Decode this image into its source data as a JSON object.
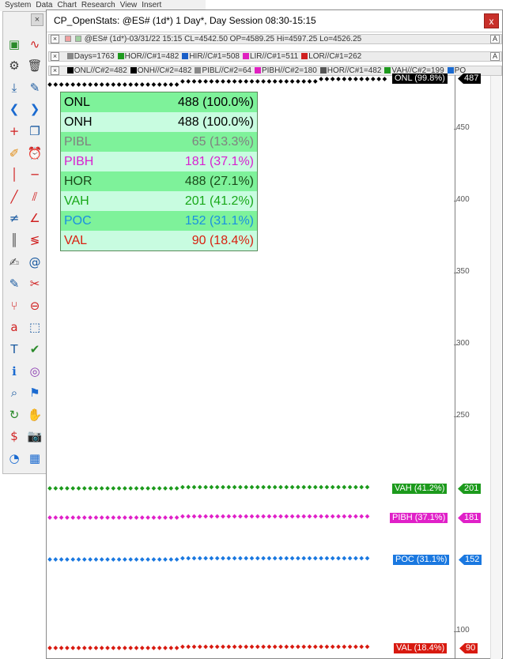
{
  "menubar": {
    "items": [
      "System",
      "Data",
      "Chart",
      "Research",
      "View",
      "Insert"
    ]
  },
  "toolbar": {
    "close_label": "×",
    "tools": [
      {
        "name": "add-chart-icon",
        "glyph": "▣",
        "color": "#2a8a2a"
      },
      {
        "name": "indicator-wave-icon",
        "glyph": "∿",
        "color": "#d02020"
      },
      {
        "name": "gear-icon",
        "glyph": "⚙",
        "color": "#3a3a3a"
      },
      {
        "name": "trash-icon",
        "glyph": "🗑",
        "color": "#3a3a3a"
      },
      {
        "name": "download-icon",
        "glyph": "⤓",
        "color": "#1a5aa0"
      },
      {
        "name": "pencil-icon",
        "glyph": "✎",
        "color": "#1a5aa0"
      },
      {
        "name": "arrow-left-icon",
        "glyph": "❮",
        "color": "#1a6ad0"
      },
      {
        "name": "arrow-right-icon",
        "glyph": "❯",
        "color": "#1a6ad0"
      },
      {
        "name": "crosshair-icon",
        "glyph": "+",
        "color": "#d02020"
      },
      {
        "name": "windows-icon",
        "glyph": "❐",
        "color": "#1a5aa0"
      },
      {
        "name": "note-icon",
        "glyph": "✐",
        "color": "#e08a10"
      },
      {
        "name": "alarm-clock-icon",
        "glyph": "⏰",
        "color": "#e08a10"
      },
      {
        "name": "vertical-line-icon",
        "glyph": "│",
        "color": "#d02020"
      },
      {
        "name": "horizontal-line-icon",
        "glyph": "─",
        "color": "#d02020"
      },
      {
        "name": "trendline-icon",
        "glyph": "╱",
        "color": "#d02020"
      },
      {
        "name": "parallel-lines-icon",
        "glyph": "⫽",
        "color": "#d02020"
      },
      {
        "name": "not-equal-icon",
        "glyph": "≠",
        "color": "#1a5aa0"
      },
      {
        "name": "fib-fan-icon",
        "glyph": "∠",
        "color": "#d02020"
      },
      {
        "name": "cycle-lines-icon",
        "glyph": "║",
        "color": "#555555"
      },
      {
        "name": "fib-retracement-icon",
        "glyph": "≶",
        "color": "#d02020"
      },
      {
        "name": "draw-pencil-icon",
        "glyph": "✍",
        "color": "#555555"
      },
      {
        "name": "spiral-icon",
        "glyph": "@",
        "color": "#1a5aa0"
      },
      {
        "name": "edit-lines-icon",
        "glyph": "✎",
        "color": "#1a5aa0"
      },
      {
        "name": "scissors-icon",
        "glyph": "✂",
        "color": "#d02020"
      },
      {
        "name": "pitchfork-icon",
        "glyph": "⑂",
        "color": "#d02020"
      },
      {
        "name": "candle-delete-icon",
        "glyph": "⊖",
        "color": "#d02020"
      },
      {
        "name": "text-tool-icon",
        "glyph": "a",
        "color": "#d02020"
      },
      {
        "name": "select-region-icon",
        "glyph": "⬚",
        "color": "#1a5aa0"
      },
      {
        "name": "title-tool-icon",
        "glyph": "T",
        "color": "#1a5aa0"
      },
      {
        "name": "spellcheck-icon",
        "glyph": "✔",
        "color": "#2a8a2a"
      },
      {
        "name": "info-icon",
        "glyph": "ℹ",
        "color": "#1a6ad0"
      },
      {
        "name": "overlay-circles-icon",
        "glyph": "◎",
        "color": "#8a3ab0"
      },
      {
        "name": "zoom-icon",
        "glyph": "⌕",
        "color": "#1a5aa0"
      },
      {
        "name": "flag-icon",
        "glyph": "⚑",
        "color": "#1a6ad0"
      },
      {
        "name": "refresh-icon",
        "glyph": "↻",
        "color": "#2a8a2a"
      },
      {
        "name": "hand-icon",
        "glyph": "✋",
        "color": "#e08a10"
      },
      {
        "name": "dollar-alert-icon",
        "glyph": "$",
        "color": "#d02020"
      },
      {
        "name": "camera-icon",
        "glyph": "📷",
        "color": "#3a3a3a"
      },
      {
        "name": "quick-search-icon",
        "glyph": "◔",
        "color": "#1a6ad0"
      },
      {
        "name": "grid-icon",
        "glyph": "▦",
        "color": "#1a6ad0"
      }
    ]
  },
  "window": {
    "title": "CP_OpenStats: @ES# (1d*) 1 Day*, Day Session 08:30-15:15",
    "close_label": "x"
  },
  "symbol_bar": {
    "close": "×",
    "text": "@ES# (1d*)-03/31/22 15:15 CL=4542.50 OP=4589.25 Hi=4597.25 Lo=4526.25",
    "a_label": "A"
  },
  "study_bar_1": {
    "close": "×",
    "items": [
      {
        "text": "Days=1763",
        "color": "#888888"
      },
      {
        "text": "HOR//C#1=482",
        "color": "#1f9a1f"
      },
      {
        "text": "HIR//C#1=508",
        "color": "#1a5fc8"
      },
      {
        "text": "LIR//C#1=511",
        "color": "#e020c0"
      },
      {
        "text": "LOR//C#1=262",
        "color": "#d02020"
      }
    ],
    "a_label": "A"
  },
  "study_bar_2": {
    "close": "×",
    "items": [
      {
        "text": "ONL//C#2=482",
        "color": "#000000"
      },
      {
        "text": "ONH//C#2=482",
        "color": "#000000"
      },
      {
        "text": "PIBL//C#2=64",
        "color": "#888888"
      },
      {
        "text": "PIBH//C#2=180",
        "color": "#e020c0"
      },
      {
        "text": "HOR//C#1=482",
        "color": "#555555"
      },
      {
        "text": "VAH//C#2=199",
        "color": "#1f9a1f"
      },
      {
        "text": "PO",
        "color": "#1a6ad0"
      }
    ]
  },
  "stats_table": [
    {
      "label": "ONL",
      "value": "488 (100.0%)",
      "color": "#000000",
      "bg": "#7ef29a"
    },
    {
      "label": "ONH",
      "value": "488 (100.0%)",
      "color": "#000000",
      "bg": "#c8fce0"
    },
    {
      "label": "PIBL",
      "value": "65 (13.3%)",
      "color": "#808080",
      "bg": "#7ef29a"
    },
    {
      "label": "PIBH",
      "value": "181 (37.1%)",
      "color": "#d820d0",
      "bg": "#c8fce0"
    },
    {
      "label": "HOR",
      "value": "488 (27.1%)",
      "color": "#1a4a1a",
      "bg": "#7ef29a"
    },
    {
      "label": "VAH",
      "value": "201 (41.2%)",
      "color": "#18a818",
      "bg": "#c8fce0"
    },
    {
      "label": "POC",
      "value": "152 (31.1%)",
      "color": "#1a90e0",
      "bg": "#7ef29a"
    },
    {
      "label": "VAL",
      "value": "90 (18.4%)",
      "color": "#d82010",
      "bg": "#c8fce0"
    }
  ],
  "y_axis_ticks": [
    "450",
    "400",
    "350",
    "300",
    "250",
    "100"
  ],
  "levels": [
    {
      "name": "ONL",
      "label": "ONL (99.8%)",
      "count": "487",
      "color": "#000000"
    },
    {
      "name": "VAH",
      "label": "VAH (41.2%)",
      "count": "201",
      "color": "#1c9a1c"
    },
    {
      "name": "PIBH",
      "label": "PIBH (37.1%)",
      "count": "181",
      "color": "#e020c8"
    },
    {
      "name": "POC",
      "label": "POC (31.1%)",
      "count": "152",
      "color": "#1a78e0"
    },
    {
      "name": "VAL",
      "label": "VAL (18.4%)",
      "count": "90",
      "color": "#d81a10"
    }
  ]
}
